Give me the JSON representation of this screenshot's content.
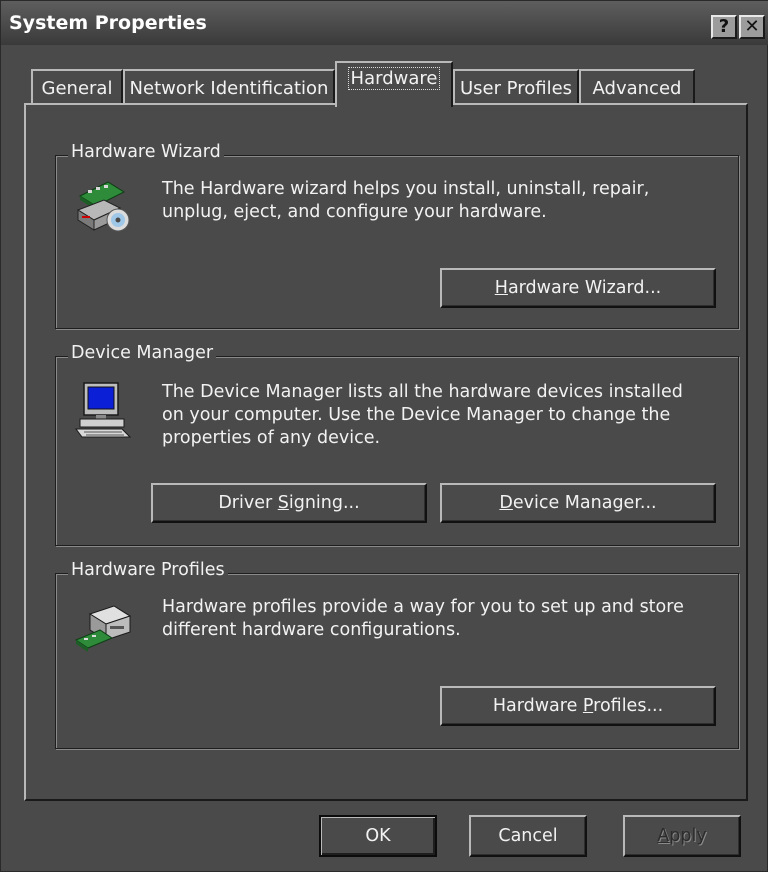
{
  "window": {
    "title": "System Properties",
    "help_glyph": "?",
    "close_glyph": "✕"
  },
  "tabs": [
    {
      "label": "General",
      "selected": false
    },
    {
      "label": "Network Identification",
      "selected": false
    },
    {
      "label": "Hardware",
      "selected": true
    },
    {
      "label": "User Profiles",
      "selected": false
    },
    {
      "label": "Advanced",
      "selected": false
    }
  ],
  "hardware_wizard": {
    "label": "Hardware Wizard",
    "description_line1": "The Hardware wizard helps you install, uninstall, repair,",
    "description_line2": "unplug, eject, and configure your hardware.",
    "button": {
      "pre": "",
      "accel": "H",
      "post": "ardware Wizard..."
    },
    "icon": "hardware-wizard-icon"
  },
  "device_manager": {
    "label": "Device Manager",
    "description_line1": "The Device Manager lists all the hardware devices installed",
    "description_line2": "on your computer. Use the Device Manager to change the",
    "description_line3": "properties of any device.",
    "driver_signing_button": {
      "pre": "Driver ",
      "accel": "S",
      "post": "igning..."
    },
    "device_manager_button": {
      "pre": "",
      "accel": "D",
      "post": "evice Manager..."
    },
    "icon": "computer-icon"
  },
  "hardware_profiles": {
    "label": "Hardware Profiles",
    "description_line1": "Hardware profiles provide a way for you to set up and store",
    "description_line2": "different hardware configurations.",
    "button": {
      "pre": "Hardware ",
      "accel": "P",
      "post": "rofiles..."
    },
    "icon": "hardware-profiles-icon"
  },
  "dialog_buttons": {
    "ok": "OK",
    "cancel": "Cancel",
    "apply": {
      "pre": "",
      "accel": "A",
      "post": "pply",
      "enabled": false
    }
  },
  "colors": {
    "background": "#4a4a4a",
    "text": "#f2f2f2",
    "highlight": "#b9b9b9",
    "shadow": "#1a1a1a",
    "disabled_text": "#2c2c2c"
  }
}
